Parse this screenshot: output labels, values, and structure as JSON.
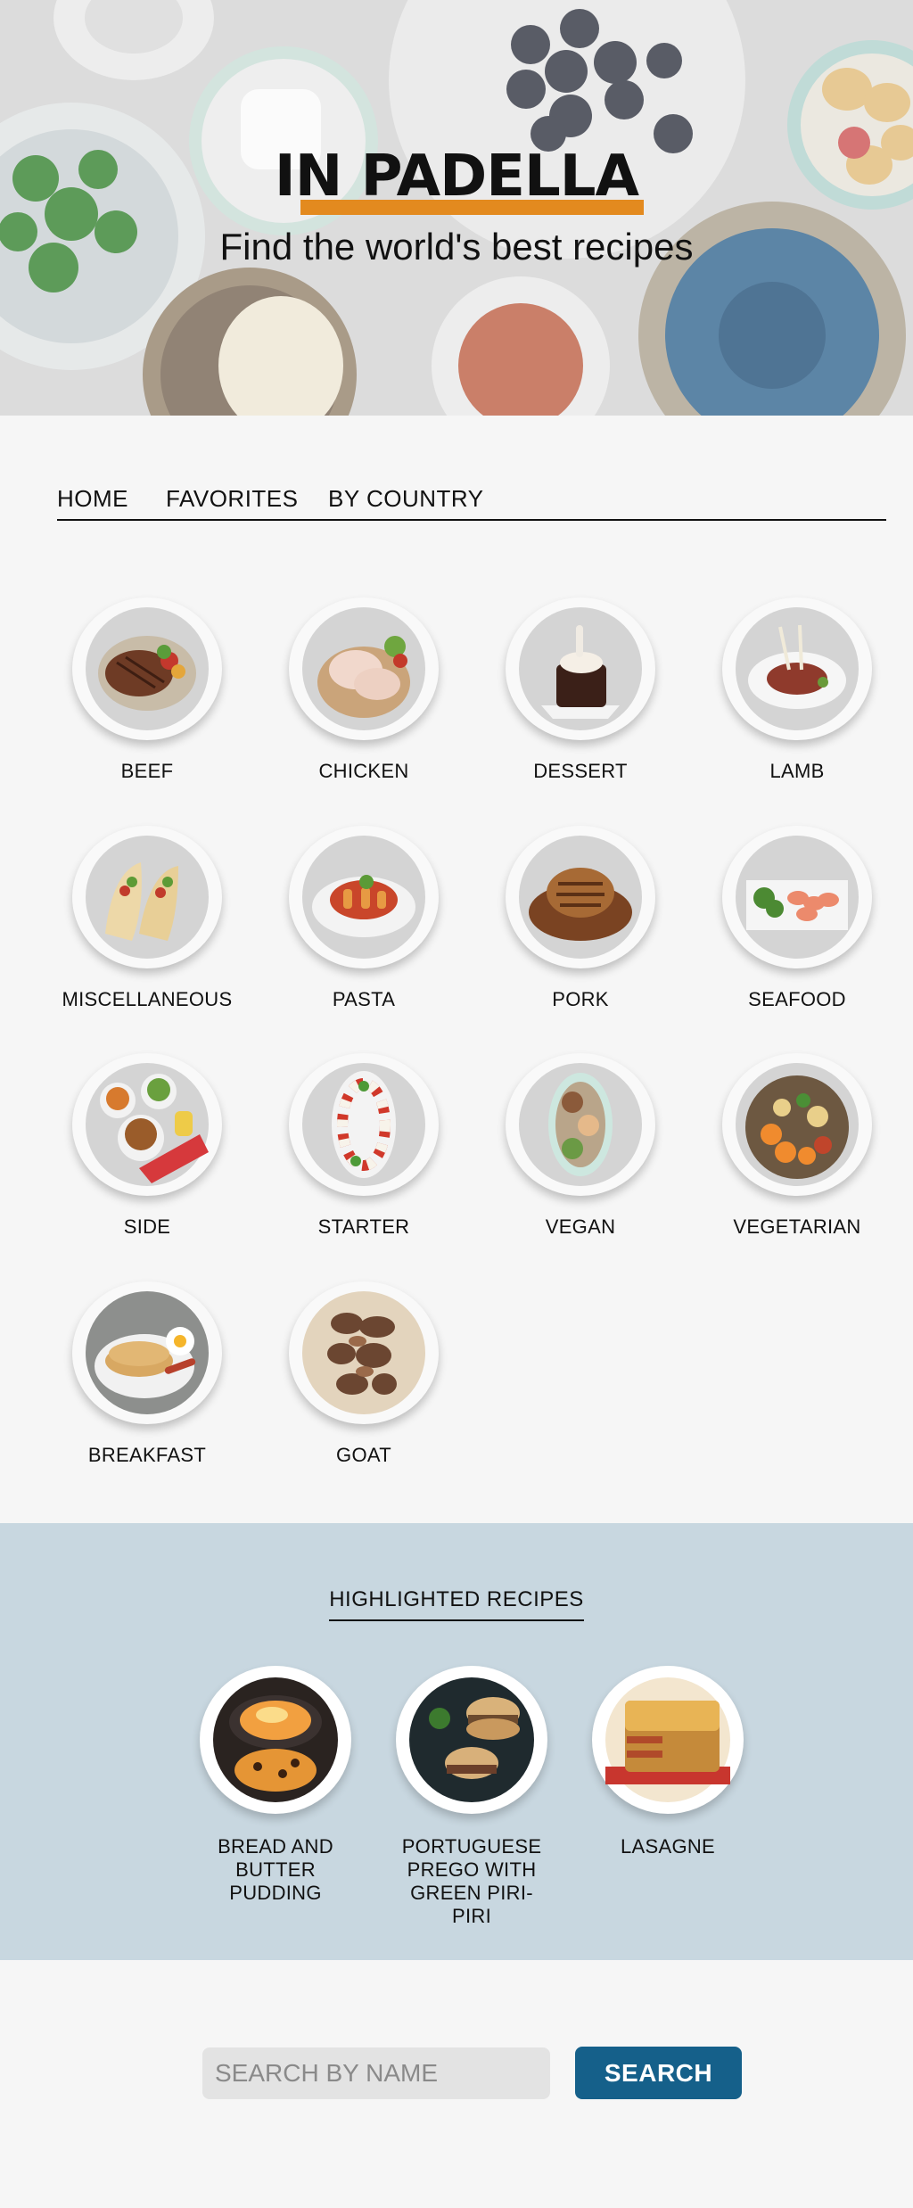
{
  "hero": {
    "logo": "IN PADELLA",
    "tagline": "Find the world's best recipes",
    "accent_color": "#e38a1f"
  },
  "nav": {
    "items": [
      {
        "label": "HOME"
      },
      {
        "label": "FAVORITES"
      },
      {
        "label": "BY COUNTRY"
      }
    ]
  },
  "categories": [
    {
      "label": "BEEF",
      "icon": "beef-dish-icon"
    },
    {
      "label": "CHICKEN",
      "icon": "chicken-dish-icon"
    },
    {
      "label": "DESSERT",
      "icon": "dessert-dish-icon"
    },
    {
      "label": "LAMB",
      "icon": "lamb-dish-icon"
    },
    {
      "label": "MISCELLANEOUS",
      "icon": "tacos-dish-icon"
    },
    {
      "label": "PASTA",
      "icon": "pasta-dish-icon"
    },
    {
      "label": "PORK",
      "icon": "pork-dish-icon"
    },
    {
      "label": "SEAFOOD",
      "icon": "seafood-dish-icon"
    },
    {
      "label": "SIDE",
      "icon": "side-dish-icon"
    },
    {
      "label": "STARTER",
      "icon": "starter-dish-icon"
    },
    {
      "label": "VEGAN",
      "icon": "vegan-dish-icon"
    },
    {
      "label": "VEGETARIAN",
      "icon": "vegetarian-dish-icon"
    },
    {
      "label": "BREAKFAST",
      "icon": "breakfast-dish-icon"
    },
    {
      "label": "GOAT",
      "icon": "goat-dish-icon"
    }
  ],
  "highlights": {
    "title": "HIGHLIGHTED RECIPES",
    "background": "#c8d7e0",
    "items": [
      {
        "label": "BREAD AND BUTTER PUDDING",
        "icon": "bread-pudding-icon"
      },
      {
        "label": "PORTUGUESE PREGO WITH GREEN PIRI-PIRI",
        "icon": "prego-sandwich-icon"
      },
      {
        "label": "LASAGNE",
        "icon": "lasagne-icon"
      }
    ]
  },
  "search": {
    "placeholder": "SEARCH BY NAME",
    "value": "",
    "button_label": "SEARCH",
    "button_color": "#15608a"
  }
}
